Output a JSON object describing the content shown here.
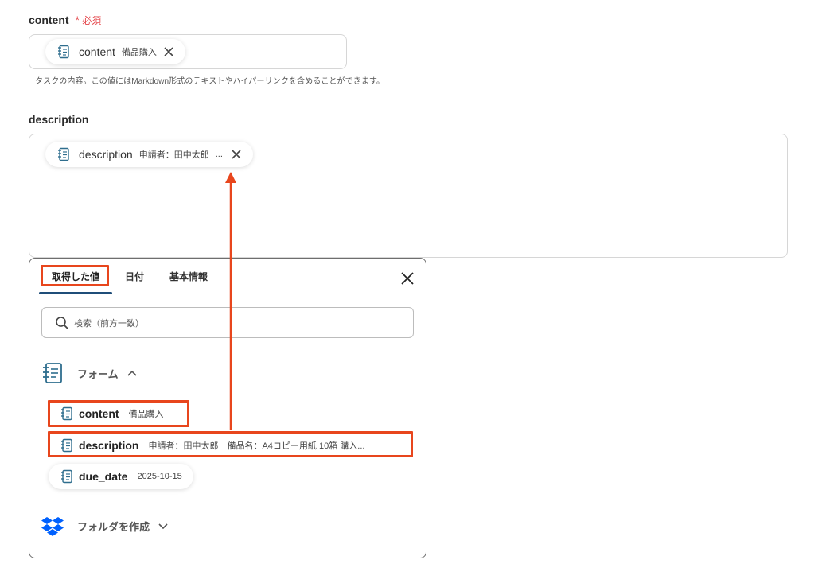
{
  "fields": {
    "content": {
      "label": "content",
      "required_mark": "*",
      "required_text": "必須",
      "chip_name": "content",
      "chip_value": "備品購入",
      "help": "タスクの内容。この値にはMarkdown形式のテキストやハイパーリンクを含めることができます。"
    },
    "description": {
      "label": "description",
      "chip_name": "description",
      "chip_value": "申請者：田中太郎",
      "chip_ellipsis": "..."
    }
  },
  "panel": {
    "tabs": [
      "取得した値",
      "日付",
      "基本情報"
    ],
    "active_tab": "取得した値",
    "search_placeholder": "検索（前方一致）",
    "groups": [
      {
        "label": "フォーム",
        "icon": "form-icon",
        "expanded": true,
        "items": [
          {
            "name": "content",
            "value": "備品購入"
          },
          {
            "name": "description",
            "value": "申請者：田中太郎　備品名：A4コピー用紙 10箱 購入..."
          },
          {
            "name": "due_date",
            "value": "2025-10-15"
          }
        ]
      },
      {
        "label": "フォルダを作成",
        "icon": "dropbox-icon",
        "expanded": false
      }
    ]
  },
  "colors": {
    "highlight": "#e8461d",
    "tab_underline": "#1f4e79",
    "dropbox_blue": "#0061fe",
    "required_red": "#e5484d"
  }
}
